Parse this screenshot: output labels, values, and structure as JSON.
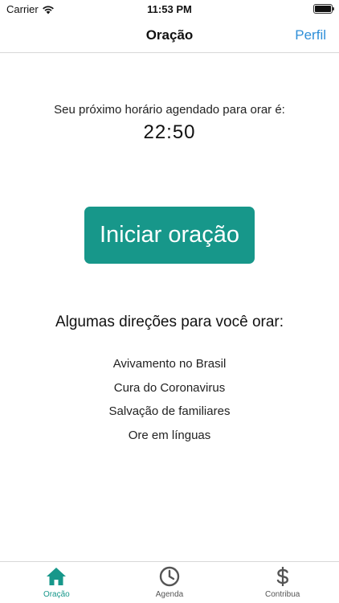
{
  "status_bar": {
    "carrier": "Carrier",
    "time": "11:53 PM"
  },
  "nav": {
    "title": "Oração",
    "right_button": "Perfil"
  },
  "schedule": {
    "label": "Seu próximo horário agendado para orar é:",
    "time": "22:50"
  },
  "start_button": {
    "label": "Iniciar oração"
  },
  "directions": {
    "title": "Algumas direções para você orar:",
    "items": [
      "Avivamento no Brasil",
      "Cura do Coronavirus",
      "Salvação de familiares",
      "Ore em línguas"
    ]
  },
  "tabs": [
    {
      "label": "Oração",
      "icon": "home-icon",
      "active": true
    },
    {
      "label": "Agenda",
      "icon": "clock-icon",
      "active": false
    },
    {
      "label": "Contribua",
      "icon": "dollar-icon",
      "active": false
    }
  ],
  "colors": {
    "accent": "#17978a",
    "link": "#2f8fd8",
    "icon_inactive": "#555555"
  }
}
